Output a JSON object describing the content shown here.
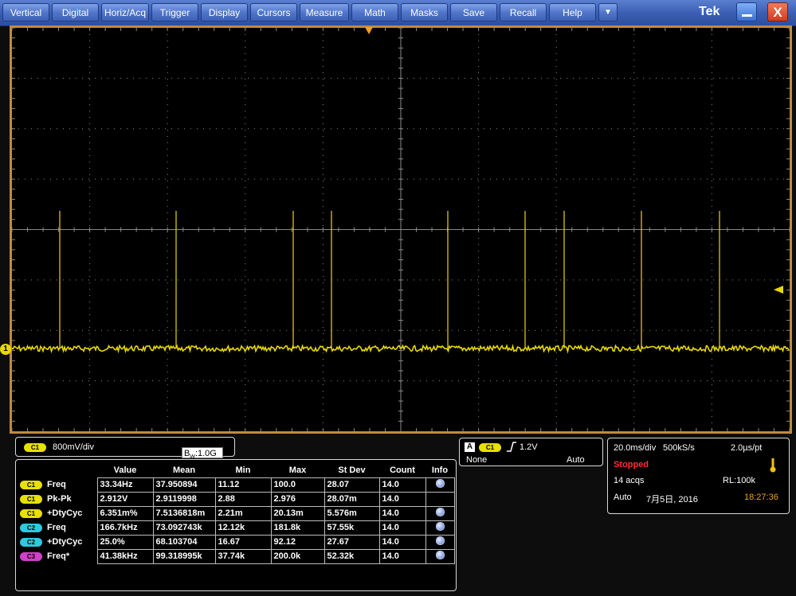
{
  "menubar": {
    "items": [
      "Vertical",
      "Digital",
      "Horiz/Acq",
      "Trigger",
      "Display",
      "Cursors",
      "Measure",
      "Math",
      "Masks",
      "Save",
      "Recall",
      "Help"
    ],
    "dropdown_glyph": "▼",
    "logo": "Tek",
    "close_glyph": "X"
  },
  "display": {
    "ch1_marker": "1",
    "trace_color": "#e8d800",
    "grid_color": "#8a8a8a",
    "frame_color": "#c08a40"
  },
  "channel": {
    "badge": "C1",
    "scale": "800mV/div",
    "bw_prefix": "B",
    "bw_sub": "W",
    "bw_value": ":1.0G"
  },
  "trigger": {
    "source_letter": "A",
    "badge": "C1",
    "level": "1.2V",
    "coupling": "None",
    "mode": "Auto"
  },
  "acquisition": {
    "timebase": "20.0ms/div",
    "sample_rate": "500kS/s",
    "per_point": "2.0µs/pt",
    "state": "Stopped",
    "acqs": "14 acqs",
    "record_length": "RL:100k",
    "mode": "Auto",
    "date": "7月5日, 2016",
    "time": "18:27:36",
    "state_color": "#ff3030",
    "time_color": "#f0a020"
  },
  "measurements": {
    "headers": [
      "Value",
      "Mean",
      "Min",
      "Max",
      "St Dev",
      "Count",
      "Info"
    ],
    "rows": [
      {
        "badge": "C1",
        "label": "Freq",
        "value": "33.34Hz",
        "mean": "37.950894",
        "min": "11.12",
        "max": "100.0",
        "stdev": "28.07",
        "count": "14.0",
        "info": true
      },
      {
        "badge": "C1",
        "label": "Pk-Pk",
        "value": "2.912V",
        "mean": "2.9119998",
        "min": "2.88",
        "max": "2.976",
        "stdev": "28.07m",
        "count": "14.0",
        "info": false
      },
      {
        "badge": "C1",
        "label": "+DtyCyc",
        "value": "6.351m%",
        "mean": "7.5136818m",
        "min": "2.21m",
        "max": "20.13m",
        "stdev": "5.576m",
        "count": "14.0",
        "info": true
      },
      {
        "badge": "C2",
        "label": "Freq",
        "value": "166.7kHz",
        "mean": "73.092743k",
        "min": "12.12k",
        "max": "181.8k",
        "stdev": "57.55k",
        "count": "14.0",
        "info": true
      },
      {
        "badge": "C2",
        "label": "+DtyCyc",
        "value": "25.0%",
        "mean": "68.103704",
        "min": "16.67",
        "max": "92.12",
        "stdev": "27.67",
        "count": "14.0",
        "info": true
      },
      {
        "badge": "C3",
        "label": "Freq*",
        "value": "41.38kHz",
        "mean": "99.318995k",
        "min": "37.74k",
        "max": "200.0k",
        "stdev": "52.32k",
        "count": "14.0",
        "info": true
      }
    ]
  }
}
